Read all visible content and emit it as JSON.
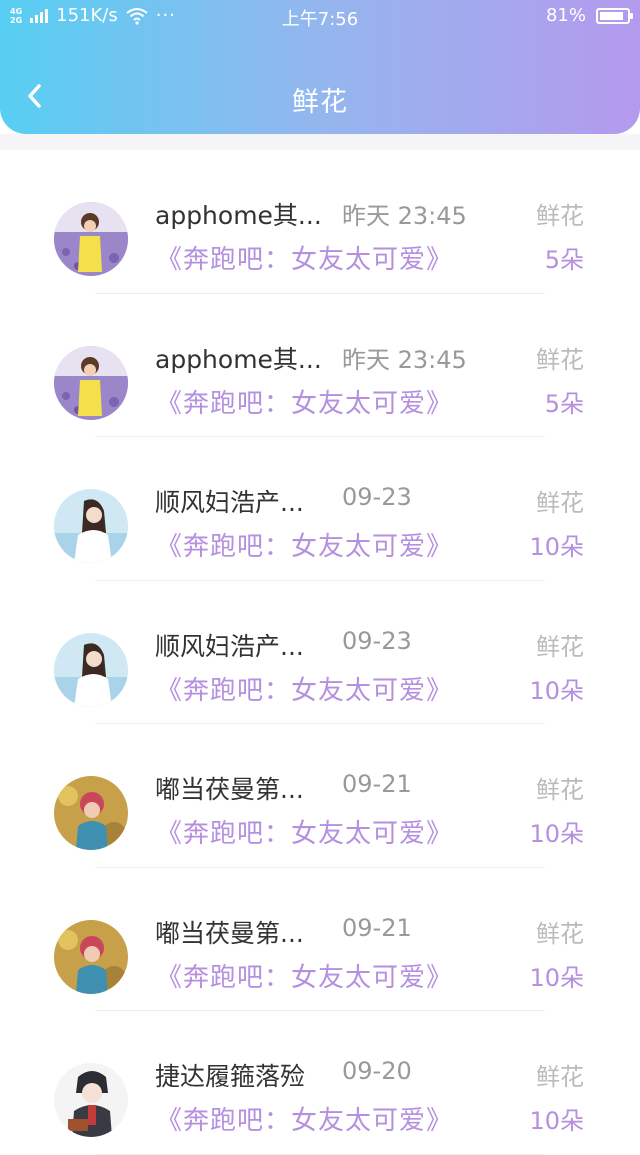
{
  "status_bar": {
    "network": "4G/2G",
    "speed": "151K/s",
    "more": "···",
    "time": "上午7:56",
    "battery": "81%"
  },
  "header": {
    "title": "鲜花",
    "back_icon": "chevron-left-icon"
  },
  "colors": {
    "gradient_start": "#57cff2",
    "gradient_end": "#b49aed",
    "accent": "#b58fe0"
  },
  "records": [
    {
      "name": "apphome其...",
      "time": "昨天 23:45",
      "kind": "鲜花",
      "work": "《奔跑吧：女友太可爱》",
      "count": "5朵",
      "avatar": "avatar-girl-flowers"
    },
    {
      "name": "apphome其...",
      "time": "昨天 23:45",
      "kind": "鲜花",
      "work": "《奔跑吧：女友太可爱》",
      "count": "5朵",
      "avatar": "avatar-girl-flowers"
    },
    {
      "name": "顺风妇浩产...",
      "time": "09-23",
      "kind": "鲜花",
      "work": "《奔跑吧：女友太可爱》",
      "count": "10朵",
      "avatar": "avatar-girl-sky"
    },
    {
      "name": "顺风妇浩产...",
      "time": "09-23",
      "kind": "鲜花",
      "work": "《奔跑吧：女友太可爱》",
      "count": "10朵",
      "avatar": "avatar-girl-sky"
    },
    {
      "name": "嘟当茯曼第...",
      "time": "09-21",
      "kind": "鲜花",
      "work": "《奔跑吧：女友太可爱》",
      "count": "10朵",
      "avatar": "avatar-girl-autumn"
    },
    {
      "name": "嘟当茯曼第...",
      "time": "09-21",
      "kind": "鲜花",
      "work": "《奔跑吧：女友太可爱》",
      "count": "10朵",
      "avatar": "avatar-girl-autumn"
    },
    {
      "name": "捷达履箍落殓",
      "time": "09-20",
      "kind": "鲜花",
      "work": "《奔跑吧：女友太可爱》",
      "count": "10朵",
      "avatar": "avatar-anime-boy"
    }
  ]
}
